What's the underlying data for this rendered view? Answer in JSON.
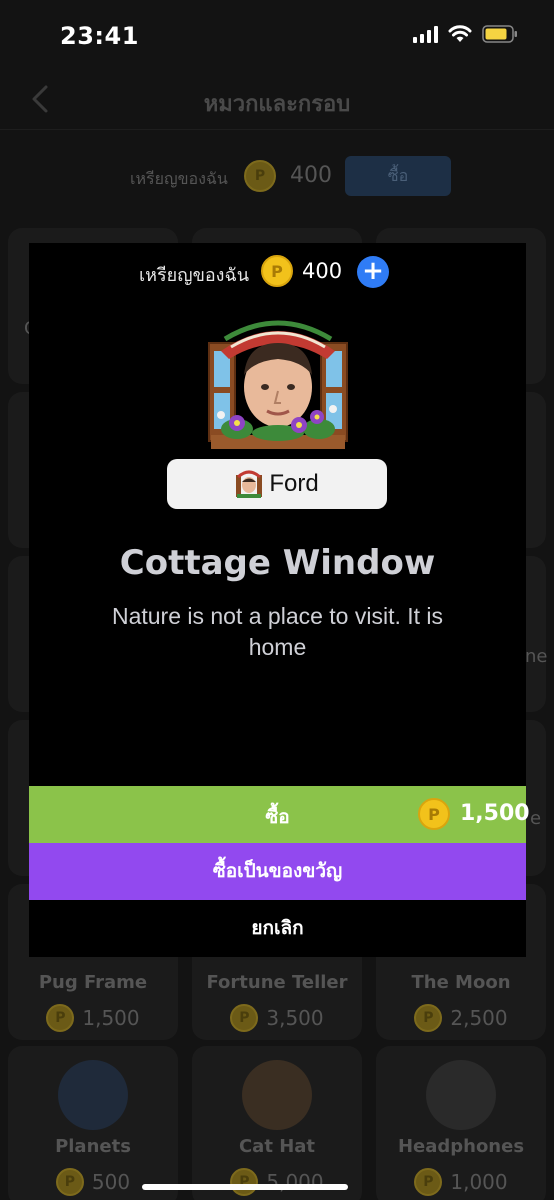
{
  "status_bar": {
    "time": "23:41"
  },
  "nav": {
    "title": "หมวกและกรอบ"
  },
  "coin_row": {
    "label": "เหรียญของฉัน",
    "coin_symbol": "P",
    "amount": "400",
    "buy_label": "ซื้อ"
  },
  "cards": [
    {
      "name": "Pug Frame",
      "price": "1,500"
    },
    {
      "name": "Fortune Teller",
      "price": "3,500"
    },
    {
      "name": "The Moon",
      "price": "2,500"
    },
    {
      "name": "Planets",
      "price": "500"
    },
    {
      "name": "Cat Hat",
      "price": "5,000"
    },
    {
      "name": "Headphones",
      "price": "1,000"
    }
  ],
  "partial_card_text": {
    "left": "C",
    "right_1": "ne",
    "right_2": "e"
  },
  "modal": {
    "coin_label": "เหรียญของฉัน",
    "coin_symbol": "P",
    "coin_amount": "400",
    "plus": "+",
    "user_name": "Ford",
    "frame_title": "Cottage Window",
    "frame_description": "Nature is not a place to visit. It is home",
    "buy_label": "ซื้อ",
    "buy_price": "1,500",
    "gift_label": "ซื้อเป็นของขวัญ",
    "cancel_label": "ยกเลิก"
  },
  "colors": {
    "buy": "#8bc34a",
    "gift": "#9249ef",
    "plus": "#2f7cf6",
    "coin": "#f2c21b"
  }
}
